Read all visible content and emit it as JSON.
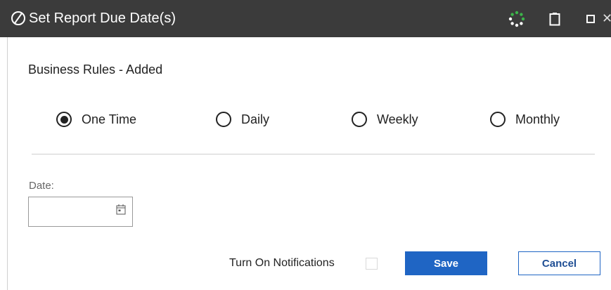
{
  "window": {
    "title": "Set Report Due Date(s)",
    "logo_icon": "slashed-circle-logo-icon",
    "controls": [
      "loading-spinner-icon",
      "clipboard-icon",
      "maximize-icon",
      "close-icon"
    ]
  },
  "section": {
    "heading": "Business Rules - Added"
  },
  "frequency": {
    "selected": "One Time",
    "options": [
      {
        "label": "One Time",
        "selected": true
      },
      {
        "label": "Daily",
        "selected": false
      },
      {
        "label": "Weekly",
        "selected": false
      },
      {
        "label": "Monthly",
        "selected": false
      }
    ]
  },
  "date": {
    "label": "Date:",
    "value": "",
    "icon": "calendar-icon"
  },
  "notifications": {
    "label": "Turn On Notifications",
    "checked": false
  },
  "buttons": {
    "save": "Save",
    "cancel": "Cancel"
  },
  "colors": {
    "titlebar": "#3b3b3b",
    "primary_button": "#1f65c4",
    "cancel_text": "#1f4e94",
    "spinner": "#3cb44a"
  }
}
